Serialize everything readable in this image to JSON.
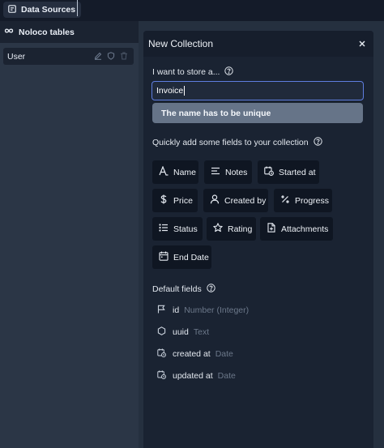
{
  "topbar": {
    "tab_label": "Data Sources"
  },
  "sidebar": {
    "header": "Noloco tables",
    "items": [
      {
        "label": "User"
      }
    ]
  },
  "modal": {
    "title": "New Collection",
    "store_label": "I want to store a...",
    "name_value": "Invoice",
    "error_message": "The name has to be unique",
    "quick_fields_label": "Quickly add some fields to your collection",
    "quick_fields": [
      {
        "label": "Name",
        "icon": "font-icon"
      },
      {
        "label": "Notes",
        "icon": "text-lines-icon"
      },
      {
        "label": "Started at",
        "icon": "calendar-clock-icon"
      },
      {
        "label": "Price",
        "icon": "dollar-icon"
      },
      {
        "label": "Created by",
        "icon": "user-icon"
      },
      {
        "label": "Progress",
        "icon": "percent-icon"
      },
      {
        "label": "Status",
        "icon": "list-icon"
      },
      {
        "label": "Rating",
        "icon": "star-icon"
      },
      {
        "label": "Attachments",
        "icon": "file-plus-icon"
      },
      {
        "label": "End Date",
        "icon": "calendar-icon"
      }
    ],
    "default_fields_label": "Default fields",
    "default_fields": [
      {
        "name": "id",
        "type": "Number (Integer)",
        "icon": "flag-icon"
      },
      {
        "name": "uuid",
        "type": "Text",
        "icon": "hexagon-icon"
      },
      {
        "name": "created at",
        "type": "Date",
        "icon": "calendar-clock-icon"
      },
      {
        "name": "updated at",
        "type": "Date",
        "icon": "calendar-clock-icon"
      }
    ]
  }
}
